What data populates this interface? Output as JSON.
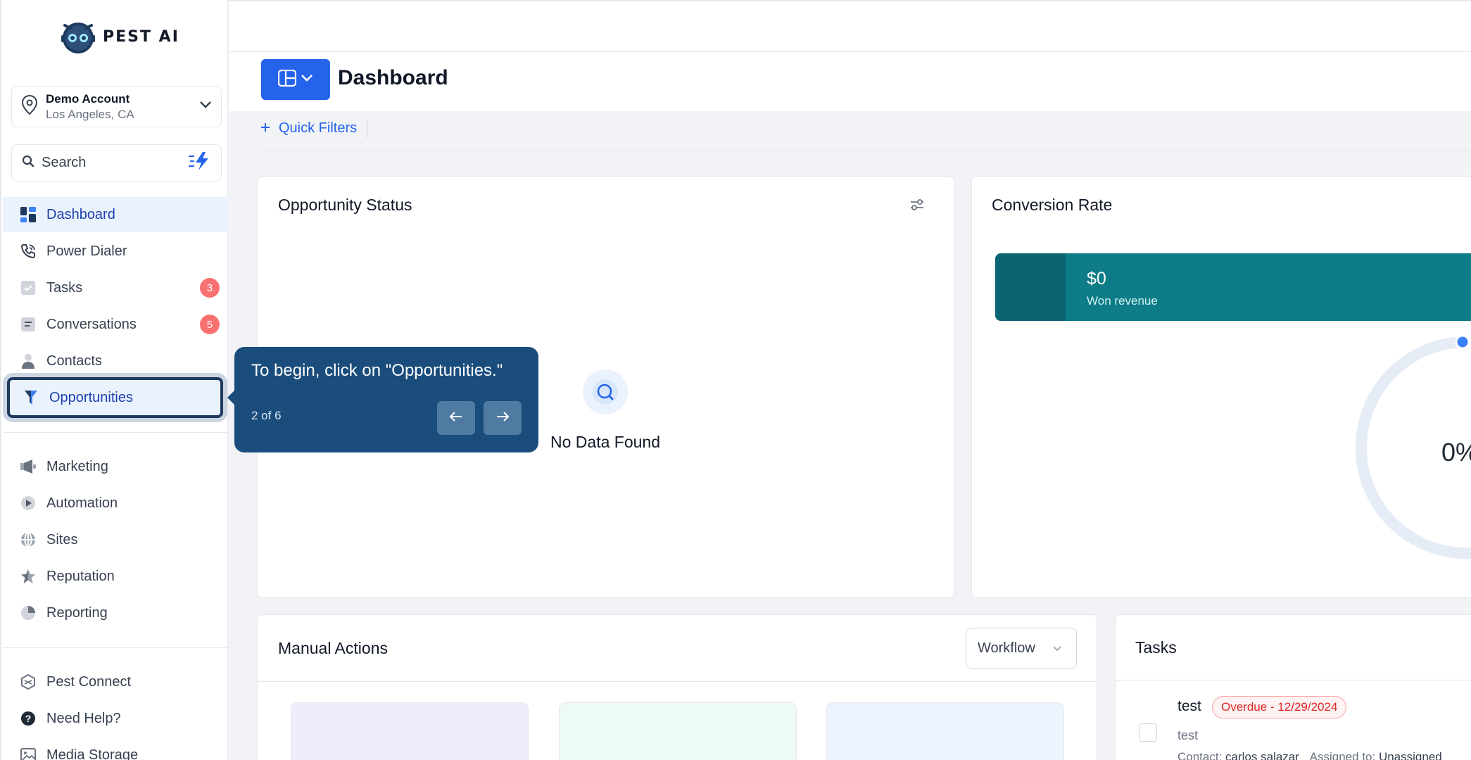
{
  "brand": {
    "name": "PEST AI"
  },
  "account": {
    "name": "Demo Account",
    "location": "Los Angeles, CA"
  },
  "search": {
    "label": "Search"
  },
  "sidebar": {
    "items": [
      {
        "label": "Dashboard",
        "icon": "dashboard-icon"
      },
      {
        "label": "Power Dialer",
        "icon": "phone-icon"
      },
      {
        "label": "Tasks",
        "icon": "check-icon",
        "badge": "3"
      },
      {
        "label": "Conversations",
        "icon": "chat-icon",
        "badge": "5"
      },
      {
        "label": "Contacts",
        "icon": "person-icon"
      },
      {
        "label": "Opportunities",
        "icon": "funnel-icon"
      },
      {
        "label": "Marketing",
        "icon": "megaphone-icon"
      },
      {
        "label": "Automation",
        "icon": "automation-icon"
      },
      {
        "label": "Sites",
        "icon": "globe-icon"
      },
      {
        "label": "Reputation",
        "icon": "star-icon"
      },
      {
        "label": "Reporting",
        "icon": "pie-icon"
      },
      {
        "label": "Pest Connect",
        "icon": "connect-icon"
      },
      {
        "label": "Need Help?",
        "icon": "help-icon"
      },
      {
        "label": "Media Storage",
        "icon": "image-icon"
      }
    ]
  },
  "header": {
    "title": "Dashboard",
    "quick_filters": "Quick Filters"
  },
  "cards": {
    "opportunity_status": {
      "title": "Opportunity Status",
      "empty": "No Data Found"
    },
    "conversion_rate": {
      "title": "Conversion Rate",
      "amount": "$0",
      "amount_label": "Won revenue",
      "percent": "0%"
    },
    "manual_actions": {
      "title": "Manual Actions",
      "filter": "Workflow"
    },
    "tasks": {
      "title": "Tasks",
      "item": {
        "name": "test",
        "status": "Overdue - 12/29/2024",
        "description": "test",
        "contact_label": "Contact:",
        "contact": "carlos salazar",
        "assigned_label": "Assigned to:",
        "assigned": "Unassigned"
      }
    }
  },
  "tooltip": {
    "message": "To begin, click on \"Opportunities.\"",
    "step": "2 of 6"
  },
  "colors": {
    "primary": "#2563eb",
    "tooltip_bg": "#1a4d7c",
    "revenue": "#0e7c86",
    "badge": "#f87171"
  }
}
